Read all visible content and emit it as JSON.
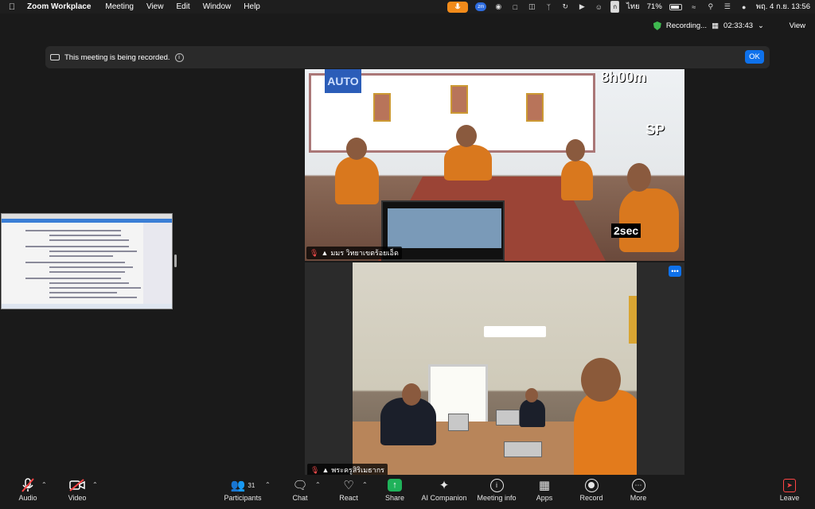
{
  "menubar": {
    "app_name": "Zoom Workplace",
    "items": [
      "Meeting",
      "View",
      "Edit",
      "Window",
      "Help"
    ],
    "zm_badge": "zm",
    "keyboard_badge": "ก",
    "input_lang": "ไทย",
    "battery": "71%",
    "datetime": "พฤ. 4 ก.ย.  13:56"
  },
  "zoom_top": {
    "recording_label": "Recording...",
    "timer": "02:33:43",
    "view_label": "View"
  },
  "banner": {
    "message": "This meeting is being recorded.",
    "ok_label": "OK"
  },
  "tiles": {
    "tile1": {
      "name": "มมร วิทยาเขตร้อยเอ็ด",
      "auto_sign": "AUTO",
      "hud_time": "8h00m",
      "hud_sp": "SP",
      "hud_sec": "2sec"
    },
    "tile2": {
      "name": "พระครูสิริเมธากร"
    }
  },
  "toolbar": {
    "audio": "Audio",
    "video": "Video",
    "participants": "Participants",
    "participants_count": "31",
    "chat": "Chat",
    "react": "React",
    "share": "Share",
    "ai_companion": "AI Companion",
    "meeting_info": "Meeting info",
    "apps": "Apps",
    "record": "Record",
    "more": "More",
    "leave": "Leave"
  }
}
